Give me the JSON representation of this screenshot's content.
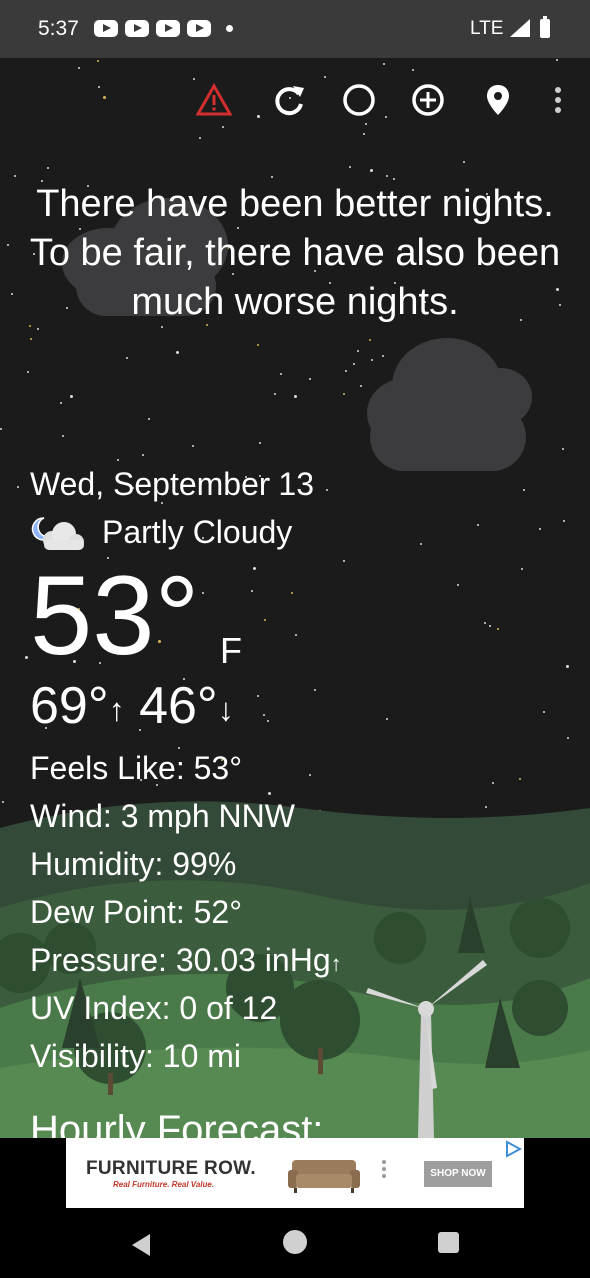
{
  "status_bar": {
    "time": "5:37",
    "network": "LTE"
  },
  "toolbar": {
    "icons": [
      "warning-icon",
      "refresh-icon",
      "moon-phase-icon",
      "add-location-icon",
      "location-pin-icon",
      "more-options-icon"
    ],
    "warning_color": "#d32f2f"
  },
  "quote": "There have been better nights. To be fair, there have also been much worse nights.",
  "current": {
    "date": "Wed, September 13",
    "condition": "Partly Cloudy",
    "condition_icon": "partly-cloudy-night-icon",
    "temperature": "53°",
    "unit": "F",
    "high": "69°",
    "low": "46°"
  },
  "details": {
    "feels_like": "Feels Like:  53°",
    "wind": "Wind:  3 mph NNW",
    "humidity": "Humidity:  99%",
    "dew_point": "Dew Point:  52°",
    "pressure": "Pressure:  30.03 inHg",
    "uv_index": "UV Index:  0 of 12",
    "visibility": "Visibility:  10 mi"
  },
  "hourly_title": "Hourly Forecast:",
  "ad": {
    "brand": "FURNITURE ROW.",
    "tagline": "Real Furniture. Real Value.",
    "cta": "SHOP NOW"
  }
}
